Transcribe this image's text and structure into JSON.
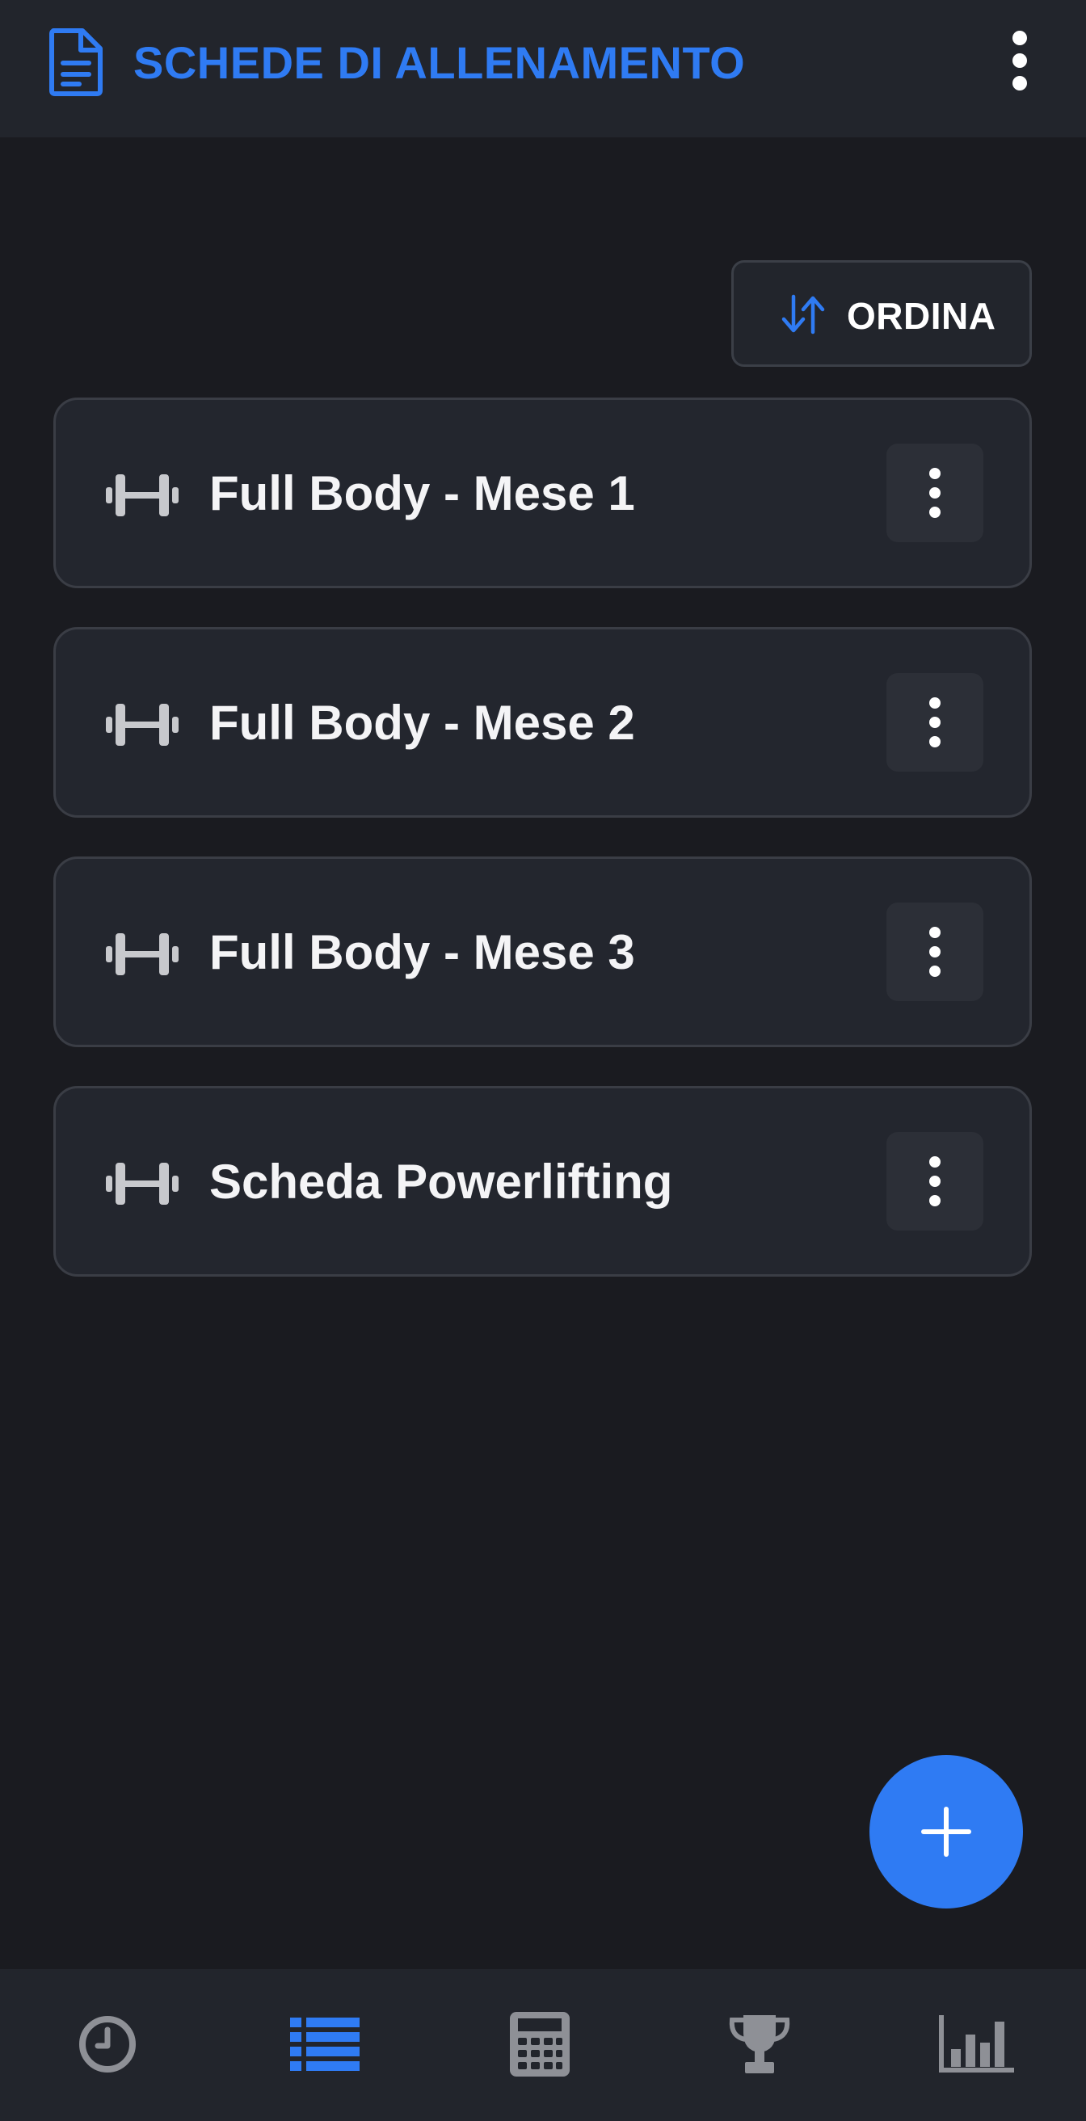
{
  "app_bar": {
    "title": "SCHEDE DI ALLENAMENTO",
    "icon": "document-icon",
    "menu_icon": "more-vertical-icon"
  },
  "sort": {
    "label": "ORDINA",
    "icon": "sort-arrows-icon"
  },
  "workouts": [
    {
      "title": "Full Body - Mese 1",
      "icon": "dumbbell-icon"
    },
    {
      "title": "Full Body - Mese 2",
      "icon": "dumbbell-icon"
    },
    {
      "title": "Full Body - Mese 3",
      "icon": "dumbbell-icon"
    },
    {
      "title": "Scheda Powerlifting",
      "icon": "dumbbell-icon"
    }
  ],
  "fab": {
    "icon": "plus-icon"
  },
  "bottom_nav": {
    "items": [
      {
        "icon": "clock-icon",
        "active": false
      },
      {
        "icon": "list-icon",
        "active": true
      },
      {
        "icon": "calculator-icon",
        "active": false
      },
      {
        "icon": "trophy-icon",
        "active": false
      },
      {
        "icon": "bar-chart-icon",
        "active": false
      }
    ]
  },
  "colors": {
    "accent": "#2f7bf3",
    "background": "#1a1b20",
    "surface": "#22252c",
    "card": "#23262e",
    "icon_inactive": "#8e9096",
    "text": "#f4f4f6"
  }
}
